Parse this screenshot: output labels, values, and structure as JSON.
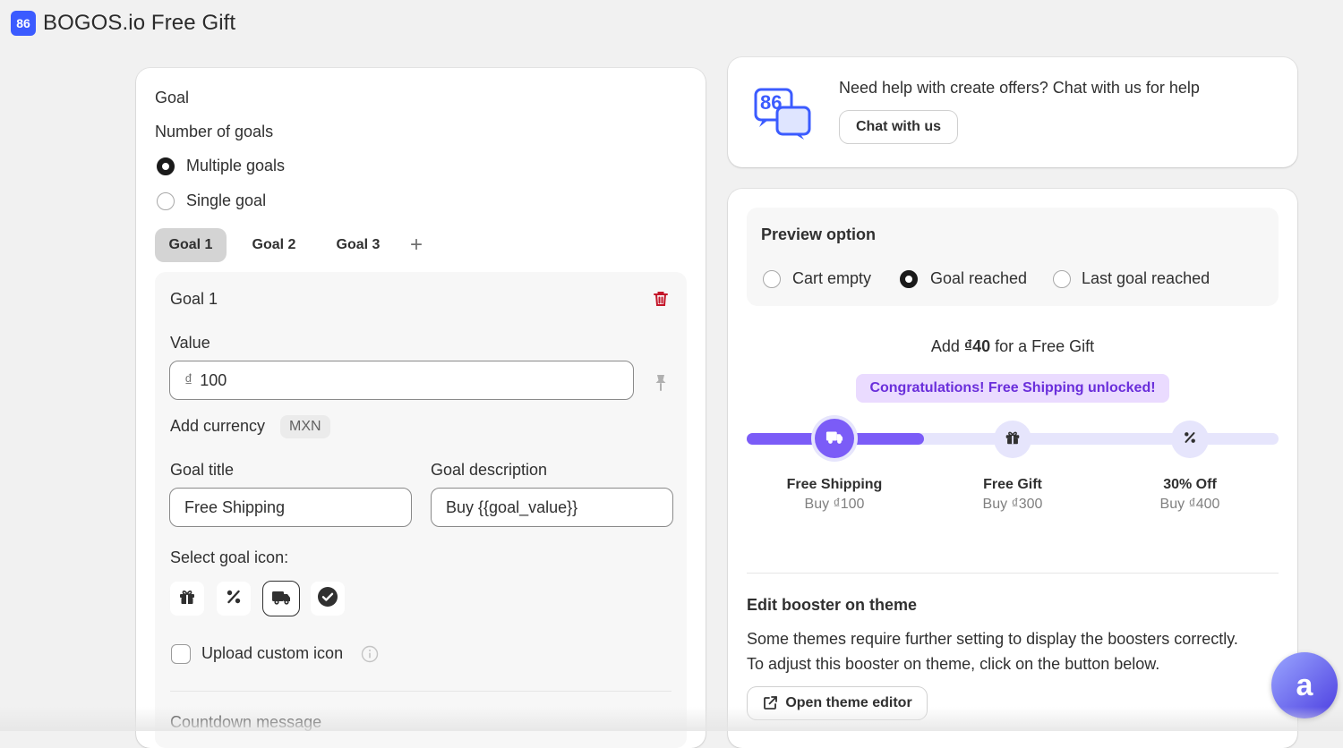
{
  "app": {
    "title": "BOGOS.io Free Gift",
    "logo_text": "86"
  },
  "goal_section": {
    "heading": "Goal",
    "number_label": "Number of goals",
    "options": [
      "Multiple goals",
      "Single goal"
    ],
    "selected_option": "Multiple goals",
    "tabs": [
      "Goal 1",
      "Goal 2",
      "Goal 3"
    ],
    "active_tab": "Goal 1",
    "add_tab_symbol": "+"
  },
  "goal_detail": {
    "title": "Goal 1",
    "value_label": "Value",
    "currency_symbol": "₫",
    "value": "100",
    "add_currency_label": "Add currency",
    "currency_badge": "MXN",
    "goal_title_label": "Goal title",
    "goal_title_value": "Free Shipping",
    "goal_description_label": "Goal description",
    "goal_description_value": "Buy {{goal_value}}",
    "select_icon_label": "Select goal icon:",
    "icons": [
      "gift-icon",
      "percent-icon",
      "truck-icon",
      "check-circle-icon"
    ],
    "selected_icon": "truck-icon",
    "upload_label": "Upload custom icon",
    "countdown_label": "Countdown message"
  },
  "help": {
    "text": "Need help with create offers? Chat with us for help",
    "button": "Chat with us",
    "logo_text": "86"
  },
  "preview": {
    "heading": "Preview option",
    "options": [
      "Cart empty",
      "Goal reached",
      "Last goal reached"
    ],
    "selected_option": "Goal reached",
    "message_prefix": "Add",
    "message_amount": "₫40",
    "message_suffix": "for a Free Gift",
    "congrats": "Congratulations! Free Shipping unlocked!",
    "progress_fraction": 0.333,
    "milestones": [
      {
        "title": "Free Shipping",
        "subtitle": "Buy ₫100",
        "icon": "truck-icon",
        "reached": true
      },
      {
        "title": "Free Gift",
        "subtitle": "Buy ₫300",
        "icon": "gift-icon",
        "reached": false
      },
      {
        "title": "30% Off",
        "subtitle": "Buy ₫400",
        "icon": "percent-icon",
        "reached": false
      }
    ]
  },
  "booster": {
    "heading": "Edit booster on theme",
    "line1": "Some themes require further setting to display the boosters correctly.",
    "line2": "To adjust this booster on theme, click on the button below.",
    "button": "Open theme editor"
  },
  "chat_widget": {
    "glyph": "a"
  },
  "colors": {
    "accent": "#7b5cf7",
    "brand": "#3b5bff",
    "danger": "#c4162a",
    "congrats_bg": "#eadbff"
  }
}
